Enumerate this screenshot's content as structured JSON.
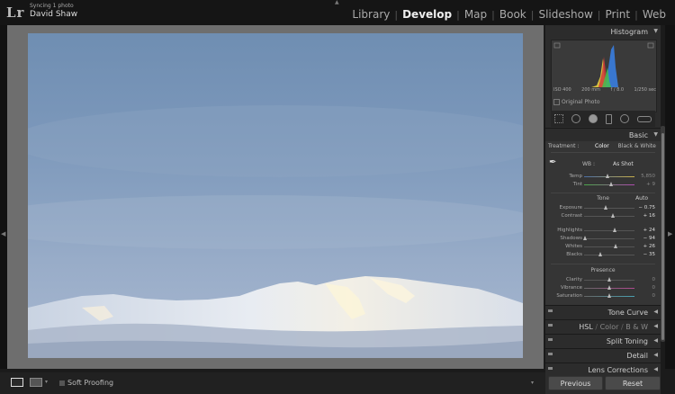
{
  "app": {
    "logo": "Lr",
    "sync_status": "Syncing 1 photo",
    "user_name": "David Shaw"
  },
  "modules": [
    {
      "label": "Library",
      "active": false
    },
    {
      "label": "Develop",
      "active": true
    },
    {
      "label": "Map",
      "active": false
    },
    {
      "label": "Book",
      "active": false
    },
    {
      "label": "Slideshow",
      "active": false
    },
    {
      "label": "Print",
      "active": false
    },
    {
      "label": "Web",
      "active": false
    }
  ],
  "histogram": {
    "title": "Histogram",
    "iso": "ISO 400",
    "focal": "200 mm",
    "aperture": "f / 8.0",
    "shutter": "1/250 sec",
    "original_photo": "Original Photo"
  },
  "basic": {
    "title": "Basic",
    "treatment_label": "Treatment :",
    "treatment_color": "Color",
    "treatment_bw": "Black & White",
    "wb_label": "WB :",
    "wb_value": "As Shot",
    "temp": {
      "label": "Temp",
      "value": "5,850",
      "level": 0.47
    },
    "tint": {
      "label": "Tint",
      "value": "+ 9",
      "level": 0.55
    },
    "tone_label": "Tone",
    "auto_label": "Auto",
    "exposure": {
      "label": "Exposure",
      "value": "− 0.75",
      "level": 0.44
    },
    "contrast": {
      "label": "Contrast",
      "value": "+ 16",
      "level": 0.58
    },
    "highlights": {
      "label": "Highlights",
      "value": "+ 24",
      "level": 0.62
    },
    "shadows": {
      "label": "Shadows",
      "value": "− 94",
      "level": 0.03
    },
    "whites": {
      "label": "Whites",
      "value": "+ 26",
      "level": 0.63
    },
    "blacks": {
      "label": "Blacks",
      "value": "− 35",
      "level": 0.33
    },
    "presence_label": "Presence",
    "clarity": {
      "label": "Clarity",
      "value": "0",
      "level": 0.5
    },
    "vibrance": {
      "label": "Vibrance",
      "value": "0",
      "level": 0.5
    },
    "saturation": {
      "label": "Saturation",
      "value": "0",
      "level": 0.5
    }
  },
  "panels": {
    "tone_curve": "Tone Curve",
    "hsl": "HSL",
    "color": "Color",
    "bw": "B & W",
    "split_toning": "Split Toning",
    "detail": "Detail",
    "lens_corrections": "Lens Corrections"
  },
  "bottom": {
    "soft_proofing": "Soft Proofing",
    "previous": "Previous",
    "reset": "Reset"
  },
  "colors": {
    "accent": "#eeeeee",
    "panel": "#2c2c2c"
  }
}
